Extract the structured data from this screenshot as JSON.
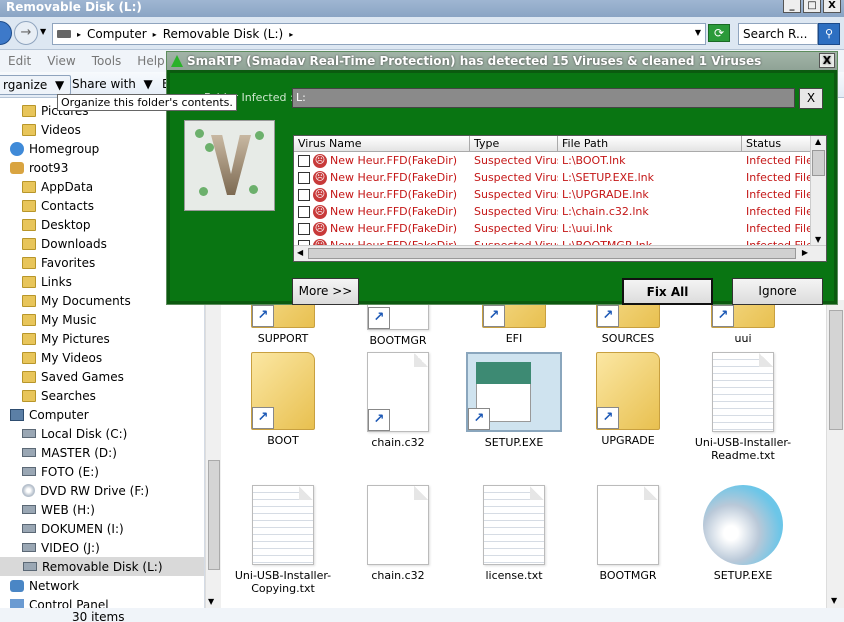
{
  "window": {
    "title": "Removable Disk (L:)",
    "minimize": "_",
    "maximize": "□",
    "close": "X"
  },
  "address": {
    "forward_glyph": "→",
    "crumbs": [
      "Computer",
      "Removable Disk (L:)"
    ],
    "search_placeholder": "Search R...",
    "search_glyph": "⚲",
    "refresh_glyph": "⟳"
  },
  "menubar": [
    "Edit",
    "View",
    "Tools",
    "Help"
  ],
  "commandbar": {
    "organize": "rganize",
    "share_with": "Share with",
    "more": "E"
  },
  "tooltip": "Organize this folder's contents.",
  "navpane": {
    "items": [
      {
        "label": "Pictures",
        "icon": "folder"
      },
      {
        "label": "Videos",
        "icon": "folder"
      },
      {
        "label": "Homegroup",
        "icon": "home"
      },
      {
        "label": "root93",
        "icon": "user"
      },
      {
        "label": "AppData",
        "icon": "folder"
      },
      {
        "label": "Contacts",
        "icon": "folder"
      },
      {
        "label": "Desktop",
        "icon": "folder"
      },
      {
        "label": "Downloads",
        "icon": "folder"
      },
      {
        "label": "Favorites",
        "icon": "folder"
      },
      {
        "label": "Links",
        "icon": "folder"
      },
      {
        "label": "My Documents",
        "icon": "folder"
      },
      {
        "label": "My Music",
        "icon": "folder"
      },
      {
        "label": "My Pictures",
        "icon": "folder"
      },
      {
        "label": "My Videos",
        "icon": "folder"
      },
      {
        "label": "Saved Games",
        "icon": "folder"
      },
      {
        "label": "Searches",
        "icon": "folder"
      },
      {
        "label": "Computer",
        "icon": "computer"
      },
      {
        "label": "Local Disk (C:)",
        "icon": "drive"
      },
      {
        "label": "MASTER (D:)",
        "icon": "drive"
      },
      {
        "label": "FOTO (E:)",
        "icon": "drive"
      },
      {
        "label": "DVD RW Drive (F:)",
        "icon": "dvd"
      },
      {
        "label": "WEB (H:)",
        "icon": "drive"
      },
      {
        "label": "DOKUMEN (I:)",
        "icon": "drive"
      },
      {
        "label": "VIDEO (J:)",
        "icon": "drive"
      },
      {
        "label": "Removable Disk (L:)",
        "icon": "drive",
        "selected": true
      },
      {
        "label": "Network",
        "icon": "network"
      },
      {
        "label": "Control Panel",
        "icon": "cpanel"
      }
    ]
  },
  "files": {
    "row1": [
      "SUPPORT",
      "BOOTMGR",
      "EFI",
      "SOURCES",
      "uui"
    ],
    "row2": [
      "BOOT",
      "chain.c32",
      "SETUP.EXE",
      "UPGRADE",
      "Uni-USB-Installer-Readme.txt"
    ],
    "row3": [
      "Uni-USB-Installer-Copying.txt",
      "chain.c32",
      "license.txt",
      "BOOTMGR",
      "SETUP.EXE"
    ],
    "shortcut_glyph": "↗"
  },
  "status": "30 items",
  "dialog": {
    "title": "SmaRTP (Smadav Real-Time Protection) has detected 15 Viruses & cleaned 1 Viruses",
    "close": "X",
    "folder_label": "Folder Infected :",
    "folder_value": "L:",
    "clear_button": "X",
    "columns": [
      "Virus Name",
      "Type",
      "File Path",
      "Status"
    ],
    "rows": [
      {
        "name": "New Heur.FFD(FakeDir)",
        "type": "Suspected Virus",
        "path": "L:\\BOOT.lnk",
        "status": "Infected File"
      },
      {
        "name": "New Heur.FFD(FakeDir)",
        "type": "Suspected Virus",
        "path": "L:\\SETUP.EXE.lnk",
        "status": "Infected File"
      },
      {
        "name": "New Heur.FFD(FakeDir)",
        "type": "Suspected Virus",
        "path": "L:\\UPGRADE.lnk",
        "status": "Infected File"
      },
      {
        "name": "New Heur.FFD(FakeDir)",
        "type": "Suspected Virus",
        "path": "L:\\chain.c32.lnk",
        "status": "Infected File"
      },
      {
        "name": "New Heur.FFD(FakeDir)",
        "type": "Suspected Virus",
        "path": "L:\\uui.lnk",
        "status": "Infected File"
      },
      {
        "name": "New Heur.FFD(FakeDir)",
        "type": "Suspected Virus",
        "path": "L:\\BOOTMGR.lnk",
        "status": "Infected File"
      }
    ],
    "more_button": "More >>",
    "fix_button": "Fix All",
    "ignore_button": "Ignore",
    "sad_glyph": "☹"
  },
  "colors": {
    "dialog_green": "#097512",
    "virus_red": "#c41616",
    "title_blue": "#8aa4c4"
  }
}
